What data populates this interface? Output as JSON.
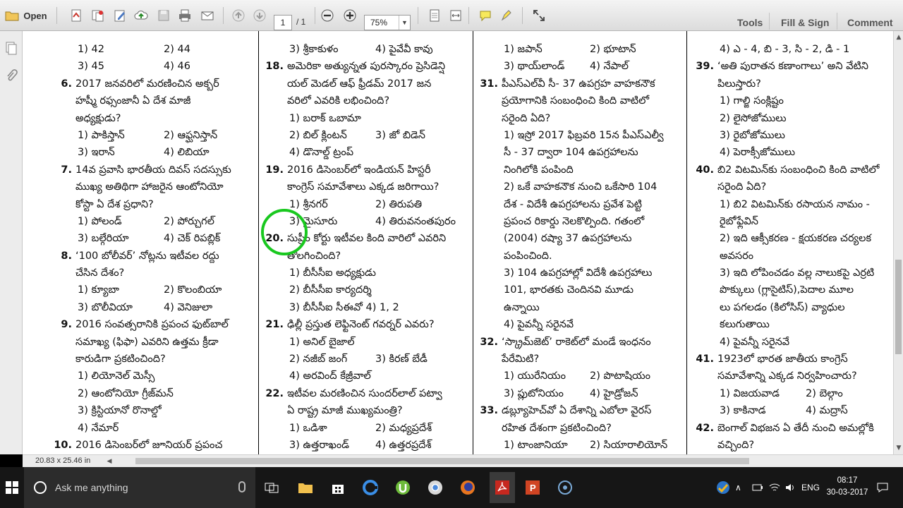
{
  "toolbar": {
    "open_label": "Open",
    "page_current": "1",
    "page_total": "/ 1",
    "zoom": "75%",
    "tools_label": "Tools",
    "fill_sign_label": "Fill & Sign",
    "comment_label": "Comment"
  },
  "status": {
    "page_size": "20.83 x 25.46 in"
  },
  "taskbar": {
    "search_placeholder": "Ask me anything",
    "lang": "ENG",
    "time": "08:17",
    "date": "30-03-2017"
  },
  "doc": {
    "col1": [
      {
        "t": "opt2",
        "a": "1) 42",
        "b": "2) 44"
      },
      {
        "t": "opt2",
        "a": "3) 45",
        "b": "4) 46"
      },
      {
        "t": "q",
        "n": "6.",
        "s": "2017 జనవరిలో మరణించిన అక్బర్"
      },
      {
        "t": "ind",
        "s": "హష్మీ రఫ్సంజానీ ఏ దేశ మాజీ"
      },
      {
        "t": "ind",
        "s": "అధ్యక్షుడు?"
      },
      {
        "t": "opt2",
        "a": "1) పాకిస్తాన్",
        "b": "2) ఆఫ్ఘనిస్తాన్"
      },
      {
        "t": "opt2",
        "a": "3) ఇరాన్",
        "b": "4) లిబియా"
      },
      {
        "t": "q",
        "n": "7.",
        "s": "14వ ప్రవాసి భారతీయ దివస్ సదస్సుకు"
      },
      {
        "t": "ind",
        "s": "ముఖ్య అతిథిగా హాజరైన ఆంటోనియో"
      },
      {
        "t": "ind",
        "s": "కోస్టా ఏ దేశ ప్రధాని?"
      },
      {
        "t": "opt2",
        "a": "1) పోలండ్",
        "b": "2) పోర్చుగల్"
      },
      {
        "t": "opt2",
        "a": "3) బల్గేరియా",
        "b": "4) చెక్ రిపబ్లిక్"
      },
      {
        "t": "q",
        "n": "8.",
        "s": "‘100 బోలీవర్’ నోట్లను ఇటీవల రద్దు"
      },
      {
        "t": "ind",
        "s": "చేసిన దేశం?"
      },
      {
        "t": "opt2",
        "a": "1) క్యూబా",
        "b": "2) కొలంబియా"
      },
      {
        "t": "opt2",
        "a": "3) బొలీవియా",
        "b": "4) వెనిజులా"
      },
      {
        "t": "q",
        "n": "9.",
        "s": "2016 సంవత్సరానికి ప్రపంచ ఫుట్‌బాల్"
      },
      {
        "t": "ind",
        "s": "సమాఖ్య (ఫిఫా) ఎవరిని ఉత్తమ క్రీడా"
      },
      {
        "t": "ind",
        "s": "కారుడిగా ప్రకటించింది?"
      },
      {
        "t": "opt",
        "s": "1) లియోనెల్ మెస్సీ"
      },
      {
        "t": "opt",
        "s": "2) ఆంటోనియో గ్రీజ్‌మన్"
      },
      {
        "t": "opt",
        "s": "3) క్రిస్టియానో రొనాల్డో"
      },
      {
        "t": "opt",
        "s": "4) నేమార్"
      },
      {
        "t": "q",
        "n": "10.",
        "s": "2016 డిసెంబర్‌లో జూనియర్ ప్రపంచ"
      }
    ],
    "col2": [
      {
        "t": "opt2",
        "a": "3) శ్రీకాకుళం",
        "b": "4) పైవేవీ కావు"
      },
      {
        "t": "q",
        "n": "18.",
        "s": "అమెరికా అత్యున్నత పురస్కారం ప్రెసిడెన్షి"
      },
      {
        "t": "ind",
        "s": "యల్ మెడల్ ఆఫ్ ఫ్రీడమ్ 2017 జన"
      },
      {
        "t": "ind",
        "s": "వరిలో ఎవరికి లభించింది?"
      },
      {
        "t": "opt",
        "s": "1) బరాక్ ఒబామా"
      },
      {
        "t": "opt2",
        "a": "2) బిల్ క్లింటన్",
        "b": "3) జో బిడెన్"
      },
      {
        "t": "opt",
        "s": "4) డొనాల్డ్ ట్రంప్"
      },
      {
        "t": "q",
        "n": "19.",
        "s": "2016 డిసెంబర్‌లో ఇండియన్ హిస్టరీ"
      },
      {
        "t": "ind",
        "s": "కాంగ్రెస్ సమావేశాలు ఎక్కడ జరిగాయి?"
      },
      {
        "t": "opt2",
        "a": "1) శ్రీనగర్",
        "b": "2) తిరుపతి"
      },
      {
        "t": "opt2",
        "a": "3) మైసూరు",
        "b": "4) తిరువనంతపురం"
      },
      {
        "t": "q",
        "n": "20.",
        "s": "సుప్రీం కోర్టు ఇటీవల కింది వారిలో ఎవరిని"
      },
      {
        "t": "ind",
        "s": "తొలగించింది?"
      },
      {
        "t": "opt",
        "s": "1) బీసీసీఐ అధ్యక్షుడు"
      },
      {
        "t": "opt",
        "s": "2) బీసీసీఐ కార్యదర్శి"
      },
      {
        "t": "opt",
        "s": "3) బీసీసీఐ సీఈవో    4) 1, 2"
      },
      {
        "t": "q",
        "n": "21.",
        "s": "ఢిల్లీ ప్రస్తుత లెఫ్టినెంట్ గవర్నర్ ఎవరు?"
      },
      {
        "t": "opt",
        "s": "1) అనిల్ బైజాల్"
      },
      {
        "t": "opt2",
        "a": "2) నజీబ్ జంగ్",
        "b": "3) కిరణ్ బేడీ"
      },
      {
        "t": "opt",
        "s": "4) అరవింద్ కేజ్రీవాల్"
      },
      {
        "t": "q",
        "n": "22.",
        "s": "ఇటీవల మరణించిన సుందర్‌లాల్ పట్వా"
      },
      {
        "t": "ind",
        "s": "ఏ రాష్ట్ర మాజీ ముఖ్యమంత్రి?"
      },
      {
        "t": "opt2",
        "a": "1) ఒడిశా",
        "b": "2) మధ్యప్రదేశ్"
      },
      {
        "t": "opt2",
        "a": "3) ఉత్తరాఖండ్",
        "b": "4) ఉత్తరప్రదేశ్"
      }
    ],
    "col3": [
      {
        "t": "opt2",
        "a": "1) జపాన్",
        "b": "2) భూటాన్"
      },
      {
        "t": "opt2",
        "a": "3) థాయ్‌లాండ్",
        "b": "4) నేపాల్"
      },
      {
        "t": "q",
        "n": "31.",
        "s": "పీఎస్ఎల్‌వీ సీ- 37 ఉపగ్రహ వాహకనౌక"
      },
      {
        "t": "ind",
        "s": "ప్రయోగానికి సంబంధించి కింది వాటిలో"
      },
      {
        "t": "ind",
        "s": "సరైంది ఏది?"
      },
      {
        "t": "opt",
        "s": "1) ఇస్రో 2017 ఫిబ్రవరి 15న పీఎస్ఎల్వీ"
      },
      {
        "t": "opt",
        "s": "    సీ - 37 ద్వారా 104 ఉపగ్రహాలను"
      },
      {
        "t": "opt",
        "s": "    నింగిలోకి పంపింది"
      },
      {
        "t": "opt",
        "s": "2) ఒకే వాహకనౌక నుంచి ఒకేసారి 104"
      },
      {
        "t": "opt",
        "s": "    దేశ - విదేశీ ఉపగ్రహాలను ప్రవేశ పెట్టి"
      },
      {
        "t": "opt",
        "s": "    ప్రపంచ రికార్డు నెలకొల్పింది. గతంలో"
      },
      {
        "t": "opt",
        "s": "    (2004) రష్యా 37 ఉపగ్రహాలను"
      },
      {
        "t": "opt",
        "s": "    పంపించింది."
      },
      {
        "t": "opt",
        "s": "3) 104 ఉపగ్రహాల్లో విదేశీ ఉపగ్రహాలు"
      },
      {
        "t": "opt",
        "s": "    101, భారతకు చెందినవి మూడు"
      },
      {
        "t": "opt",
        "s": "    ఉన్నాయి"
      },
      {
        "t": "opt",
        "s": "4) పైవన్నీ సరైనవే"
      },
      {
        "t": "q",
        "n": "32.",
        "s": "‘స్క్రామ్‌జెట్’ రాకెట్‌లో మండే ఇంధనం"
      },
      {
        "t": "ind",
        "s": "పేరేమిటి?"
      },
      {
        "t": "opt2",
        "a": "1) యురేనియం",
        "b": "2) పొటాషియం"
      },
      {
        "t": "opt2",
        "a": "3) ప్లుటోనియం",
        "b": "4) హైడ్రోజన్"
      },
      {
        "t": "q",
        "n": "33.",
        "s": "డబ్ల్యూహెచ్‌వో ఏ దేశాన్ని ఎబోలా వైరస్"
      },
      {
        "t": "ind",
        "s": "రహిత దేశంగా ప్రకటించింది?"
      },
      {
        "t": "opt2",
        "a": "1) టాంజానియా",
        "b": "2) సియారాలియోన్"
      }
    ],
    "col4": [
      {
        "t": "opt",
        "s": "4) ఎ - 4, బి - 3, సి - 2, డి - 1"
      },
      {
        "t": "q",
        "n": "39.",
        "s": "‘అతి పురాతన కణాంగాలు’ అని వేటిని"
      },
      {
        "t": "ind",
        "s": "పిలుస్తారు?"
      },
      {
        "t": "opt",
        "s": "1) గాల్జి సంక్లిష్టం"
      },
      {
        "t": "opt",
        "s": "2) లైసోజోములు"
      },
      {
        "t": "opt",
        "s": "3) రైబోజోములు"
      },
      {
        "t": "opt",
        "s": "4) పెరాక్సీజోములు"
      },
      {
        "t": "q",
        "n": "40.",
        "s": "బి2 విటమిన్‌కు సంబంధించి కింది వాటిలో"
      },
      {
        "t": "ind",
        "s": "సరైంది ఏది?"
      },
      {
        "t": "opt",
        "s": "1) బి2 విటమిన్‌కు రసాయన నామం -"
      },
      {
        "t": "opt",
        "s": "    రైబోఫ్లేవిన్"
      },
      {
        "t": "opt",
        "s": "2) ఇది ఆక్సీకరణ - క్షయకరణ చర్యలక"
      },
      {
        "t": "opt",
        "s": "    అవసరం"
      },
      {
        "t": "opt",
        "s": "3) ఇది లోపించడం వల్ల నాలుకపై ఎర్రటి"
      },
      {
        "t": "opt",
        "s": "    పొక్కులు (గ్లాసైటిస్),పెదాల మూల"
      },
      {
        "t": "opt",
        "s": "    లు పగలడం (కిలోసిస్) వ్యాధుల"
      },
      {
        "t": "opt",
        "s": "    కలుగుతాయి"
      },
      {
        "t": "opt",
        "s": "4) పైవన్నీ సరైనవే"
      },
      {
        "t": "q",
        "n": "41.",
        "s": "1923లో భారత జాతీయ కాంగ్రెస్"
      },
      {
        "t": "ind",
        "s": "సమావేశాన్ని ఎక్కడ నిర్వహించారు?"
      },
      {
        "t": "opt2",
        "a": "1) విజయవాడ",
        "b": "2) బెల్గాం"
      },
      {
        "t": "opt2",
        "a": "3) కాకినాడ",
        "b": "4) మద్రాస్"
      },
      {
        "t": "q",
        "n": "42.",
        "s": "బెంగాల్ విభజన ఏ తేదీ నుంచి అమల్లోకి"
      },
      {
        "t": "ind",
        "s": "వచ్చింది?"
      }
    ]
  }
}
